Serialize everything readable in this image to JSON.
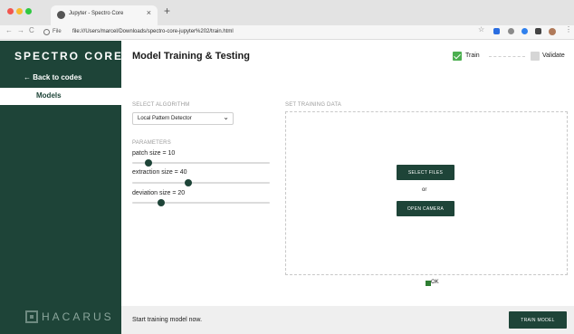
{
  "browser": {
    "tab_title": "Jupyter - Spectro Core",
    "tab_close": "×",
    "new_tab": "+",
    "url_scheme": "File",
    "url": "file:///Users/marcel/Downloads/spectro-core-jupyter%202/train.html",
    "nav_back": "←",
    "nav_forward": "→",
    "nav_reload": "C",
    "bookmark_star": "☆",
    "menu": "⋮"
  },
  "sidebar": {
    "brand": "SPECTRO CORE",
    "back_link": "← Back to codes",
    "nav_models": "Models",
    "footer_logo": "HACARUS"
  },
  "main": {
    "title": "Model Training & Testing",
    "modes": {
      "train_label": "Train",
      "train_checked": true,
      "validate_label": "Validate",
      "validate_checked": false
    },
    "algorithm": {
      "section_label": "SELECT ALGORITHM",
      "selected": "Local Pattern Detector",
      "caret": "⌄"
    },
    "parameters": {
      "section_label": "PARAMETERS",
      "patch": {
        "label": "patch size = 10",
        "value": 10,
        "fraction": 0.12
      },
      "extraction": {
        "label": "extraction size = 40",
        "value": 40,
        "fraction": 0.41
      },
      "deviation": {
        "label": "deviation size = 20",
        "value": 20,
        "fraction": 0.21
      }
    },
    "training_data": {
      "section_label": "SET TRAINING DATA",
      "select_files": "SELECT FILES",
      "or": "or",
      "open_camera": "OPEN CAMERA",
      "ok_label": "OK"
    }
  },
  "footer": {
    "status": "Start training model now.",
    "train_button": "TRAIN MODEL"
  },
  "colors": {
    "sidebar_bg": "#1e4438",
    "accent_green": "#4caf50",
    "button_bg": "#1e4438"
  }
}
